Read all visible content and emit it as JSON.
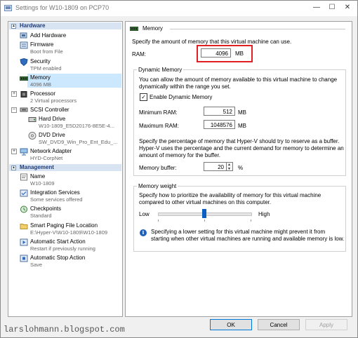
{
  "window": {
    "title": "Settings for W10-1809 on PCP70",
    "minimize": "—",
    "maximize": "☐",
    "close": "✕"
  },
  "sidebar": {
    "hardware_header": "Hardware",
    "management_header": "Management",
    "hardware_items": [
      {
        "name": "Add Hardware",
        "sub": "",
        "icon": "add-hardware-icon"
      },
      {
        "name": "Firmware",
        "sub": "Boot from File",
        "icon": "firmware-icon"
      },
      {
        "name": "Security",
        "sub": "TPM enabled",
        "icon": "shield-icon"
      },
      {
        "name": "Memory",
        "sub": "4096 MB",
        "icon": "memory-icon"
      },
      {
        "name": "Processor",
        "sub": "2 Virtual processors",
        "icon": "processor-icon"
      },
      {
        "name": "SCSI Controller",
        "sub": "",
        "icon": "scsi-icon"
      },
      {
        "name": "Hard Drive",
        "sub": "W10-1809_E5D20176-8E5E-4...",
        "icon": "hard-drive-icon"
      },
      {
        "name": "DVD Drive",
        "sub": "SW_DVD9_Win_Pro_Ent_Edu_...",
        "icon": "dvd-drive-icon"
      },
      {
        "name": "Network Adapter",
        "sub": "HYD-CorpNet",
        "icon": "network-adapter-icon"
      }
    ],
    "management_items": [
      {
        "name": "Name",
        "sub": "W10-1809",
        "icon": "name-icon"
      },
      {
        "name": "Integration Services",
        "sub": "Some services offered",
        "icon": "integration-icon"
      },
      {
        "name": "Checkpoints",
        "sub": "Standard",
        "icon": "checkpoints-icon"
      },
      {
        "name": "Smart Paging File Location",
        "sub": "E:\\Hyper-V\\W10-1809\\W10-1809",
        "icon": "folder-icon"
      },
      {
        "name": "Automatic Start Action",
        "sub": "Restart if previously running",
        "icon": "start-action-icon"
      },
      {
        "name": "Automatic Stop Action",
        "sub": "Save",
        "icon": "stop-action-icon"
      }
    ]
  },
  "memory": {
    "header": "Memory",
    "intro": "Specify the amount of memory that this virtual machine can use.",
    "ram_label": "RAM:",
    "ram_value": "4096",
    "unit": "MB",
    "dynamic": {
      "legend": "Dynamic Memory",
      "desc1": "You can allow the amount of memory available to this virtual machine to change",
      "desc2": "dynamically within the range you set.",
      "checkbox_label": "Enable Dynamic Memory",
      "checkbox_checked": true,
      "min_label": "Minimum RAM:",
      "min_value": "512",
      "max_label": "Maximum RAM:",
      "max_value": "1048576",
      "buffer_desc1": "Specify the percentage of memory that Hyper-V should try to reserve as a buffer.",
      "buffer_desc2": "Hyper-V uses the percentage and the current demand for memory to determine an",
      "buffer_desc3": "amount of memory for the buffer.",
      "buffer_label": "Memory buffer:",
      "buffer_value": "20",
      "buffer_unit": "%"
    },
    "weight": {
      "legend": "Memory weight",
      "desc1": "Specify how to prioritize the availability of memory for this virtual machine",
      "desc2": "compared to other virtual machines on this computer.",
      "low": "Low",
      "high": "High",
      "slider_fraction": 0.5,
      "info1": "Specifying a lower setting for this virtual machine might prevent it from",
      "info2": "starting when other virtual machines are running and available memory is low."
    }
  },
  "buttons": {
    "ok": "OK",
    "cancel": "Cancel",
    "apply": "Apply"
  },
  "watermark": "larslohmann.blogspot.com"
}
